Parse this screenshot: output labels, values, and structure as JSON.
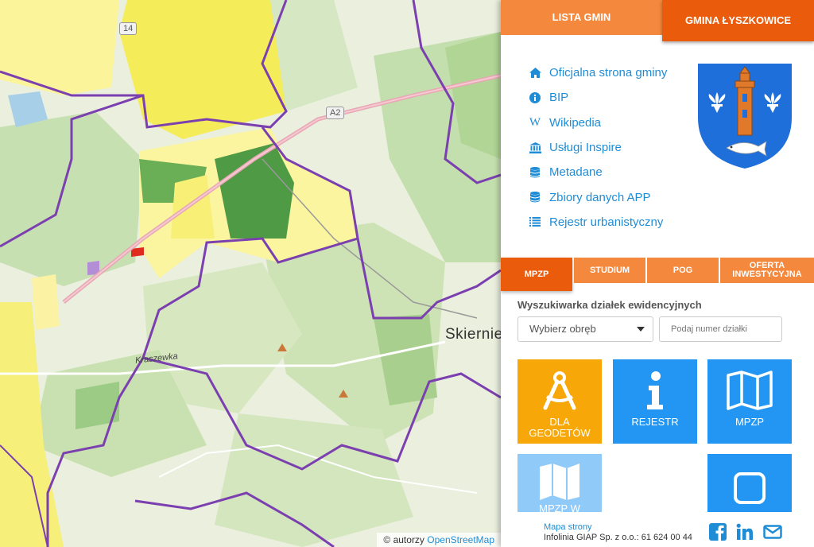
{
  "map": {
    "road_label_a2": "A2",
    "road_label_14": "14",
    "city_label": "Skiernie",
    "village_label": "Kraszewka",
    "attribution_prefix": "© autorzy",
    "attribution_link": "OpenStreetMap"
  },
  "panel": {
    "tabs": {
      "lista_gmin": "LISTA GMIN",
      "gmina": "GMINA ŁYSZKOWICE"
    },
    "links": [
      {
        "label": "Oficjalna strona gminy",
        "icon": "home-icon"
      },
      {
        "label": "BIP",
        "icon": "info-circle-icon"
      },
      {
        "label": "Wikipedia",
        "icon": "wikipedia-icon"
      },
      {
        "label": "Usługi Inspire",
        "icon": "bank-icon"
      },
      {
        "label": "Metadane",
        "icon": "database-icon"
      },
      {
        "label": "Zbiory danych APP",
        "icon": "database-icon"
      },
      {
        "label": "Rejestr urbanistyczny",
        "icon": "list-icon"
      }
    ],
    "mid_tabs": {
      "mpzp": "MPZP",
      "studium": "STUDIUM",
      "pog": "POG",
      "oferta_line1": "OFERTA",
      "oferta_line2": "INWESTYCYJNA"
    },
    "search": {
      "title": "Wyszukiwarka działek ewidencyjnych",
      "select_value": "Wybierz obręb",
      "input_placeholder": "Podaj numer działki"
    },
    "tiles": {
      "geodeci_line1": "DLA",
      "geodeci_line2": "GEODETÓW",
      "rejestr": "REJESTR",
      "mpzp": "MPZP",
      "mpzp_w": "MPZP W"
    },
    "footer": {
      "sitemap": "Mapa strony",
      "infolinia": "Infolinia GIAP Sp. z o.o.: 61 624 00 44"
    },
    "colors": {
      "tab_orange": "#f4883d",
      "tab_active": "#ea5c0c",
      "link_blue": "#1f8dd6",
      "tile_yellow": "#f7a707",
      "tile_blue": "#2396f3",
      "tile_light_blue": "#90caf9",
      "coa_blue": "#1e6fd9"
    }
  }
}
